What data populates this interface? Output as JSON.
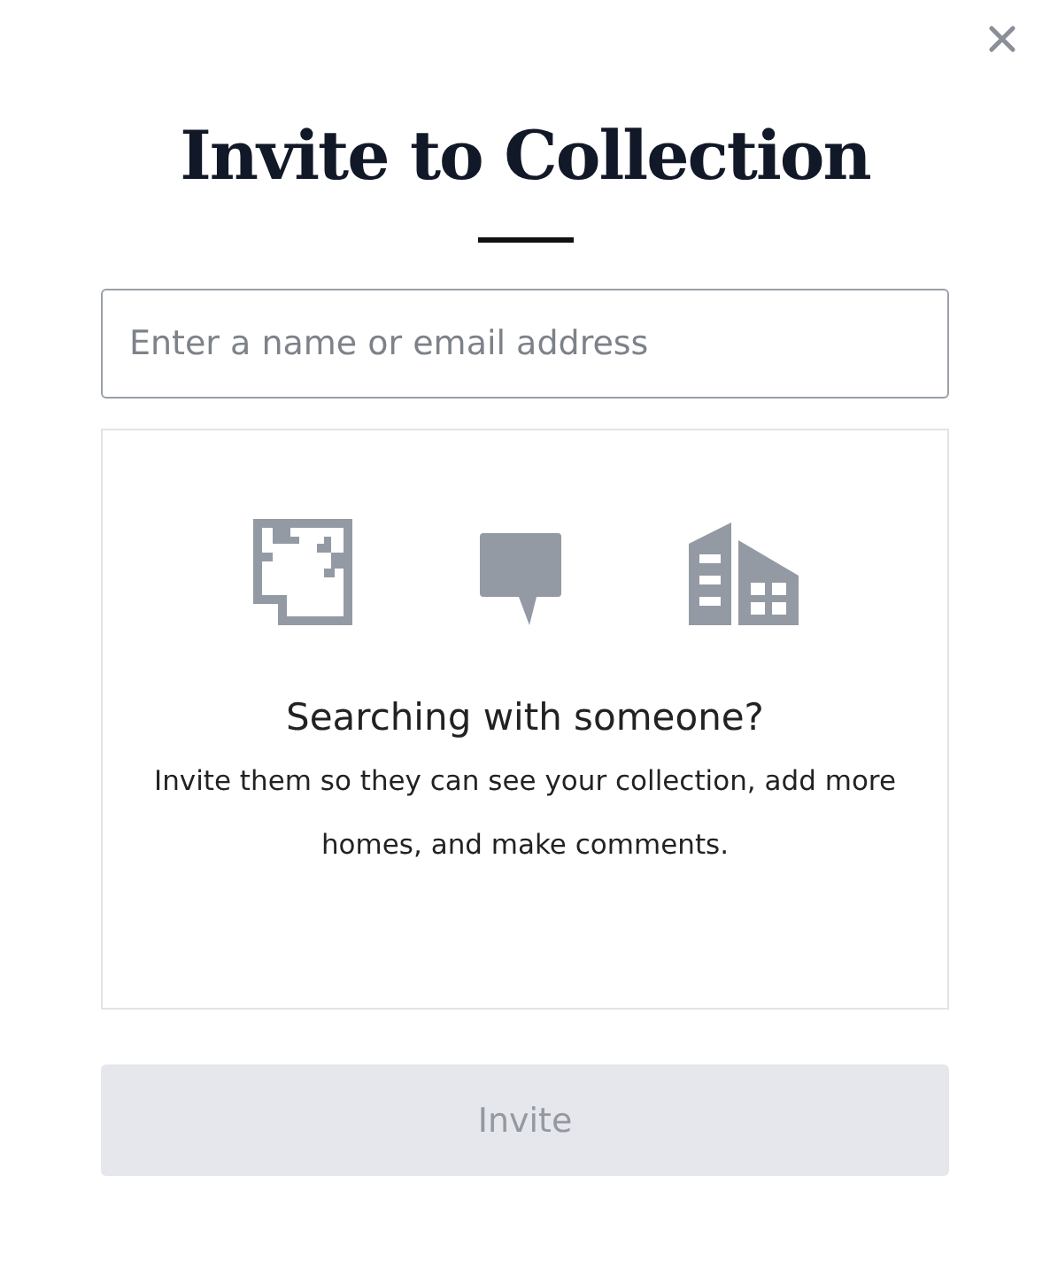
{
  "title": "Invite to Collection",
  "search": {
    "placeholder": "Enter a name or email address"
  },
  "info": {
    "heading": "Searching with someone?",
    "text": "Invite them so they can see your collection, add more homes, and make comments."
  },
  "invite_button": {
    "label": "Invite",
    "disabled": true
  }
}
